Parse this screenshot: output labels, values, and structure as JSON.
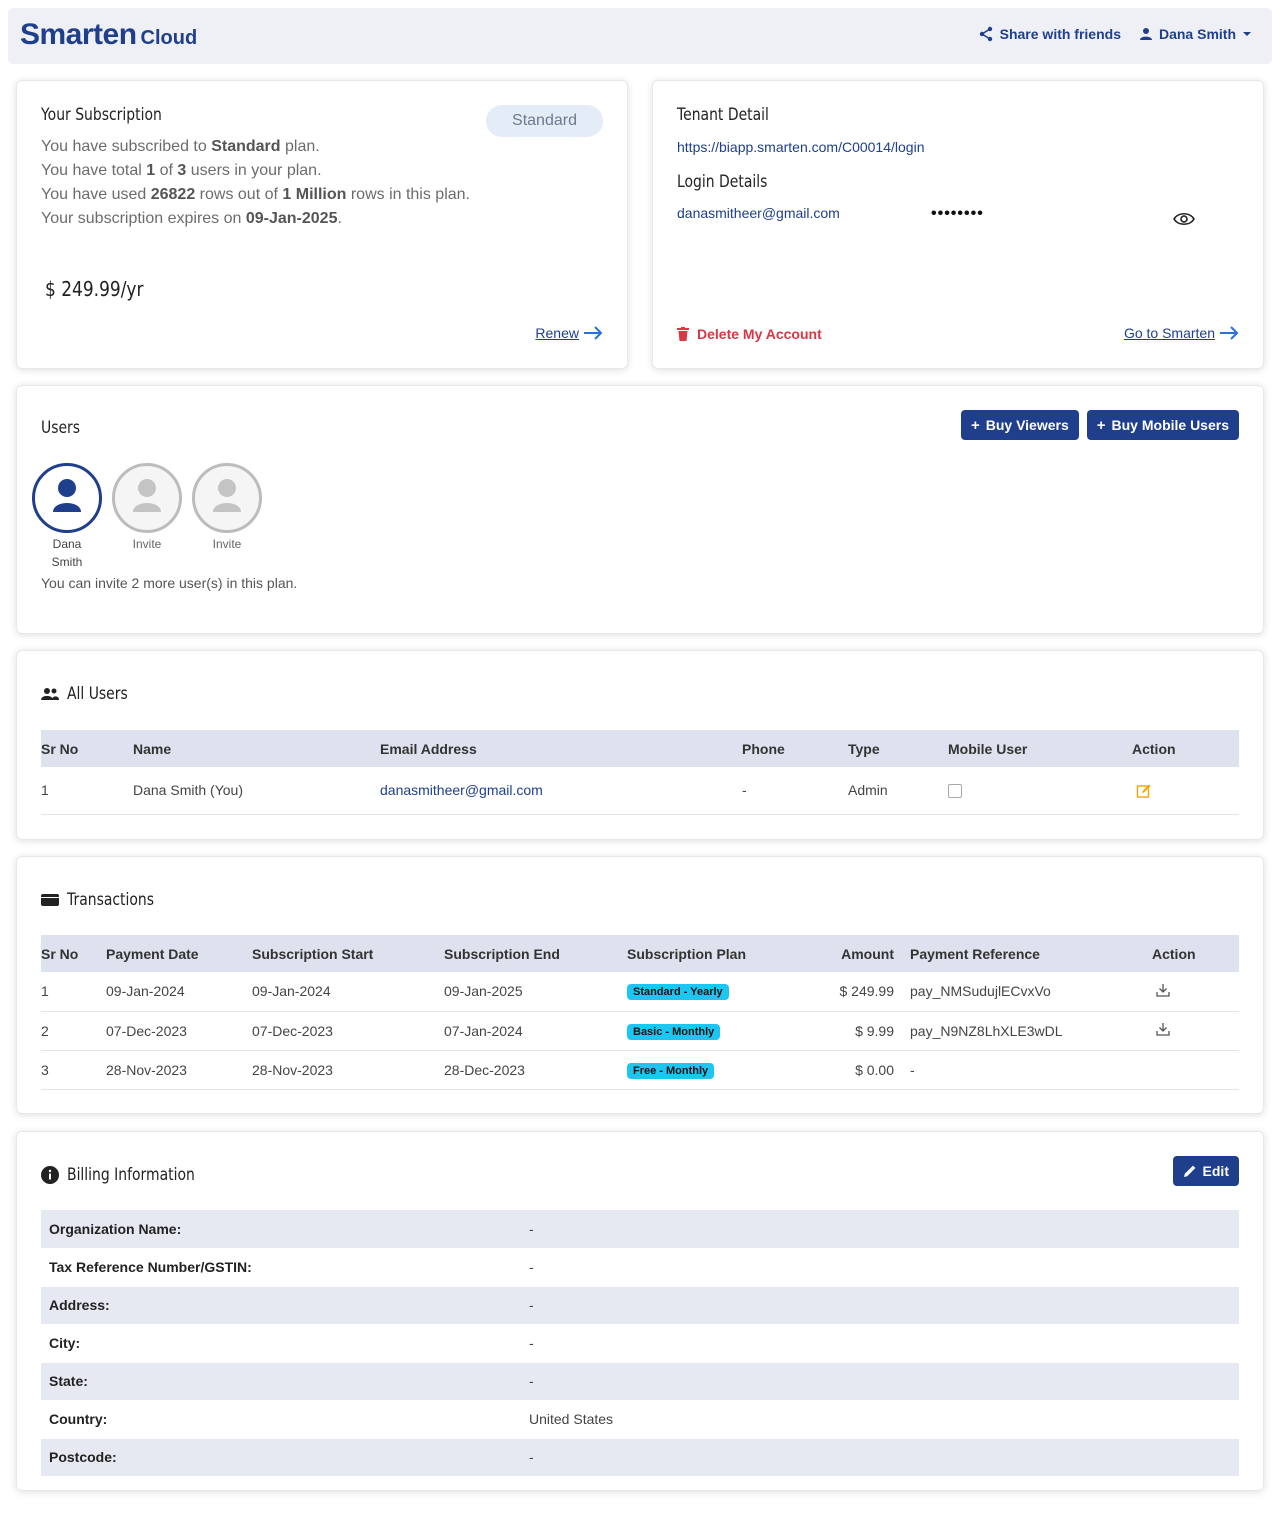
{
  "brand": {
    "name": "Smarten",
    "suffix": "Cloud",
    "color": "#1f3f8c"
  },
  "nav": {
    "share_label": "Share with friends",
    "user_label": "Dana Smith",
    "share_icon": "share-icon",
    "user_icon": "user-icon"
  },
  "subscription": {
    "title": "Your Subscription",
    "plan_badge": "Standard",
    "lines": {
      "l1_pre": "You have subscribed to ",
      "l1_b": "Standard",
      "l1_post": " plan.",
      "l2_pre": "You have total ",
      "l2_b1": "1",
      "l2_mid": " of ",
      "l2_b2": "3",
      "l2_post": " users in your plan.",
      "l3_pre": "You have used ",
      "l3_b1": "26822",
      "l3_mid": " rows out of ",
      "l3_b2": "1 Million",
      "l3_post": " rows in this plan.",
      "l4_pre": "Your subscription expires on ",
      "l4_b": "09-Jan-2025",
      "l4_post": "."
    },
    "price": "$ 249.99/yr",
    "renew_label": "Renew"
  },
  "tenant": {
    "title": "Tenant Detail",
    "url": "https://biapp.smarten.com/C00014/login",
    "login_title": "Login Details",
    "email": "danasmitheer@gmail.com",
    "password_mask": "••••••••",
    "delete_label": "Delete My Account",
    "goto_label": "Go to Smarten"
  },
  "users": {
    "title": "Users",
    "buy_viewers": "Buy Viewers",
    "buy_mobile": "Buy Mobile Users",
    "avatars": [
      {
        "label1": "Dana",
        "label2": "Smith"
      },
      {
        "label": "Invite"
      },
      {
        "label": "Invite"
      }
    ],
    "note": "You can invite 2 more user(s) in this plan."
  },
  "all_users": {
    "title": "All Users",
    "columns": [
      "Sr No",
      "Name",
      "Email Address",
      "Phone",
      "Type",
      "Mobile User",
      "Action"
    ],
    "rows": [
      {
        "sr": "1",
        "name": "Dana Smith (You)",
        "email": "danasmitheer@gmail.com",
        "phone": "-",
        "type": "Admin"
      }
    ]
  },
  "transactions": {
    "title": "Transactions",
    "columns": [
      "Sr No",
      "Payment Date",
      "Subscription Start",
      "Subscription End",
      "Subscription Plan",
      "Amount",
      "Payment Reference",
      "Action"
    ],
    "rows": [
      {
        "sr": "1",
        "date": "09-Jan-2024",
        "start": "09-Jan-2024",
        "end": "09-Jan-2025",
        "plan": "Standard - Yearly",
        "amount": "$ 249.99",
        "ref": "pay_NMSudujlECvxVo"
      },
      {
        "sr": "2",
        "date": "07-Dec-2023",
        "start": "07-Dec-2023",
        "end": "07-Jan-2024",
        "plan": "Basic - Monthly",
        "amount": "$ 9.99",
        "ref": "pay_N9NZ8LhXLE3wDL"
      },
      {
        "sr": "3",
        "date": "28-Nov-2023",
        "start": "28-Nov-2023",
        "end": "28-Dec-2023",
        "plan": "Free - Monthly",
        "amount": "$ 0.00",
        "ref": "-"
      }
    ]
  },
  "billing": {
    "title": "Billing Information",
    "edit_label": "Edit",
    "rows": [
      {
        "label": "Organization Name:",
        "value": "-"
      },
      {
        "label": "Tax Reference Number/GSTIN:",
        "value": "-"
      },
      {
        "label": "Address:",
        "value": "-"
      },
      {
        "label": "City:",
        "value": "-"
      },
      {
        "label": "State:",
        "value": "-"
      },
      {
        "label": "Country:",
        "value": "United States"
      },
      {
        "label": "Postcode:",
        "value": "-"
      }
    ]
  }
}
